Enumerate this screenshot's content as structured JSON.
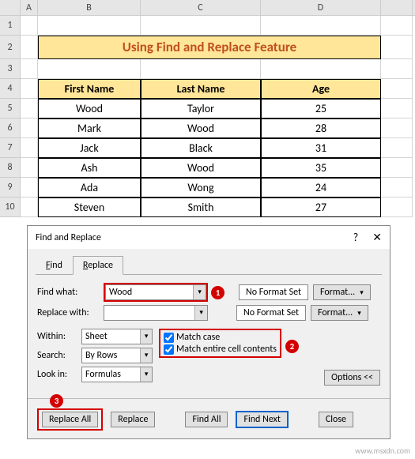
{
  "columns": {
    "A": "A",
    "B": "B",
    "C": "C",
    "D": "D",
    "E": "E"
  },
  "title": "Using Find and Replace Feature",
  "headers": {
    "first": "First Name",
    "last": "Last Name",
    "age": "Age"
  },
  "rows": [
    {
      "first": "Wood",
      "last": "Taylor",
      "age": "25"
    },
    {
      "first": "Mark",
      "last": "Wood",
      "age": "28"
    },
    {
      "first": "Jack",
      "last": "Black",
      "age": "31"
    },
    {
      "first": "Ash",
      "last": "Wood",
      "age": "35"
    },
    {
      "first": "Ada",
      "last": "Wong",
      "age": "24"
    },
    {
      "first": "Steven",
      "last": "Smith",
      "age": "27"
    }
  ],
  "rownums": [
    "1",
    "2",
    "3",
    "4",
    "5",
    "6",
    "7",
    "8",
    "9",
    "10"
  ],
  "dialog": {
    "title": "Find and Replace",
    "tabs": {
      "find": "Find",
      "replace": "Replace"
    },
    "findwhat_label": "Find what:",
    "replacewith_label": "Replace with:",
    "findwhat_value": "Wood",
    "replacewith_value": "",
    "nofmt": "No Format Set",
    "format_btn": "Format...",
    "within_label": "Within:",
    "within_value": "Sheet",
    "search_label": "Search:",
    "search_value": "By Rows",
    "lookin_label": "Look in:",
    "lookin_value": "Formulas",
    "match_case": "Match case",
    "match_entire": "Match entire cell contents",
    "options_btn": "Options <<",
    "replace_all": "Replace All",
    "replace_btn": "Replace",
    "find_all": "Find All",
    "find_next": "Find Next",
    "close_btn": "Close"
  },
  "callouts": {
    "c1": "1",
    "c2": "2",
    "c3": "3"
  },
  "watermark": "www.msxdn.com"
}
